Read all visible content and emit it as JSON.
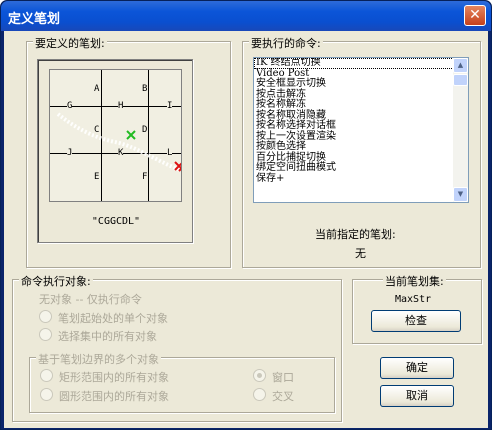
{
  "window": {
    "title": "定义笔划",
    "close_glyph": "✕"
  },
  "stroke_group": {
    "label": "要定义的笔划:",
    "grid_letters": [
      "A",
      "B",
      "G",
      "H",
      "I",
      "C",
      "D",
      "J",
      "K",
      "L",
      "E",
      "F"
    ],
    "stroke_code": "\"CGGCDL\"",
    "marker_colors": {
      "start": "#22bb22",
      "end": "#dd1111"
    }
  },
  "command_group": {
    "label": "要执行的命令:",
    "commands": [
      "IK 终结点切换",
      "Video Post",
      "安全框显示切换",
      "按点击解冻",
      "按名称解冻",
      "按名称取消隐藏",
      "按名称选择对话框",
      "按上一次设置渲染",
      "按颜色选择",
      "百分比捕捉切换",
      "绑定空间扭曲模式",
      "保存+"
    ],
    "current_label": "当前指定的笔划:",
    "current_value": "无"
  },
  "target_group": {
    "label": "命令执行对象:",
    "none_option": "无对象 -- 仅执行命令",
    "single_option": "笔划起始处的单个对象",
    "all_selected_option": "选择集中的所有对象",
    "multi_group_label": "基于笔划边界的多个对象",
    "rect_option": "矩形范围内的所有对象",
    "circle_option": "圆形范围内的所有对象",
    "window_option": "窗口",
    "crossing_option": "交叉"
  },
  "set_group": {
    "label": "当前笔划集:",
    "set_name": "MaxStr",
    "check_button": "检查"
  },
  "buttons": {
    "ok": "确定",
    "cancel": "取消"
  }
}
